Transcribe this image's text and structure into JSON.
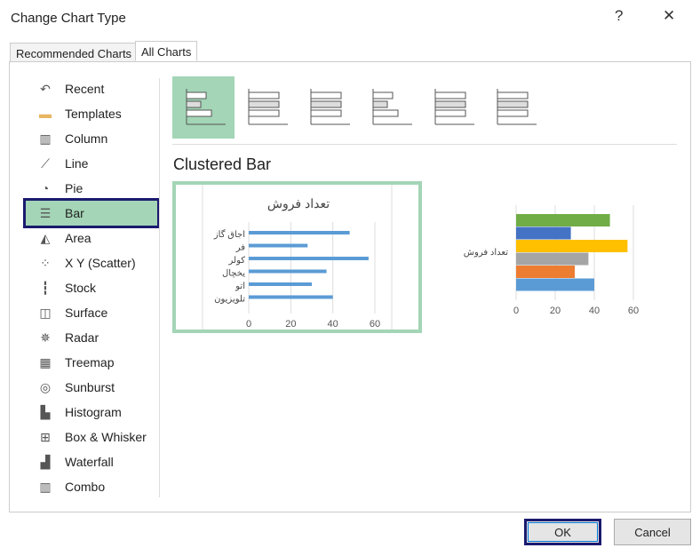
{
  "dialog": {
    "title": "Change Chart Type",
    "help": "?",
    "close": "✕"
  },
  "tabs": [
    {
      "label": "Recommended Charts"
    },
    {
      "label": "All Charts",
      "active": true
    }
  ],
  "sidebar": {
    "items": [
      {
        "label": "Recent",
        "icon": "recent-icon"
      },
      {
        "label": "Templates",
        "icon": "folder-icon"
      },
      {
        "label": "Column",
        "icon": "column-chart-icon"
      },
      {
        "label": "Line",
        "icon": "line-chart-icon"
      },
      {
        "label": "Pie",
        "icon": "pie-chart-icon"
      },
      {
        "label": "Bar",
        "icon": "bar-chart-icon",
        "selected": true
      },
      {
        "label": "Area",
        "icon": "area-chart-icon"
      },
      {
        "label": "X Y (Scatter)",
        "icon": "scatter-chart-icon"
      },
      {
        "label": "Stock",
        "icon": "stock-chart-icon"
      },
      {
        "label": "Surface",
        "icon": "surface-chart-icon"
      },
      {
        "label": "Radar",
        "icon": "radar-chart-icon"
      },
      {
        "label": "Treemap",
        "icon": "treemap-icon"
      },
      {
        "label": "Sunburst",
        "icon": "sunburst-icon"
      },
      {
        "label": "Histogram",
        "icon": "histogram-icon"
      },
      {
        "label": "Box & Whisker",
        "icon": "box-whisker-icon"
      },
      {
        "label": "Waterfall",
        "icon": "waterfall-icon"
      },
      {
        "label": "Combo",
        "icon": "combo-chart-icon"
      }
    ]
  },
  "subtype_title": "Clustered Bar",
  "colors": {
    "selected": "#a3d5b6",
    "highlight": "#1a1a6e",
    "bar": "#5b9bd5"
  },
  "chart_data": [
    {
      "type": "bar",
      "orientation": "horizontal",
      "title": "تعداد فروش",
      "categories": [
        "اجاق گاز",
        "فر",
        "کولر",
        "یخچال",
        "اتو",
        "تلویزیون"
      ],
      "values": [
        48,
        28,
        57,
        37,
        30,
        40
      ],
      "xlim": [
        0,
        60
      ],
      "xticks": [
        "0",
        "20",
        "40",
        "60"
      ],
      "grid": true
    },
    {
      "type": "bar",
      "orientation": "horizontal",
      "category_label": "تعداد فروش",
      "values": [
        48,
        28,
        57,
        37,
        30,
        40
      ],
      "colors": [
        "#70ad47",
        "#4472c4",
        "#ffc000",
        "#a5a5a5",
        "#ed7d31",
        "#5b9bd5"
      ],
      "xlim": [
        0,
        60
      ],
      "xticks": [
        "0",
        "20",
        "40",
        "60"
      ],
      "grid": true
    }
  ],
  "buttons": {
    "ok": "OK",
    "cancel": "Cancel"
  }
}
